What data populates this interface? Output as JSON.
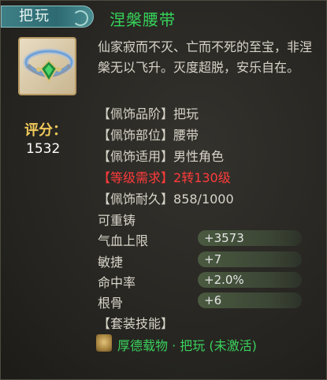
{
  "badge_label": "把玩",
  "item_name": "涅槃腰带",
  "icon": "jade-belt-icon",
  "description": "仙家寂而不灭、亡而不死的至宝，非涅槃无以飞升。灭度超脱，安乐自在。",
  "score": {
    "label": "评分：",
    "value": "1532"
  },
  "attributes": [
    {
      "key": "【佩饰品阶】",
      "value": "把玩"
    },
    {
      "key": "【佩饰部位】",
      "value": "腰带"
    },
    {
      "key": "【佩饰适用】",
      "value": "男性角色"
    },
    {
      "key": "【等级需求】",
      "value": "2转130级"
    },
    {
      "key": "【佩饰耐久】",
      "value": "858/1000"
    }
  ],
  "recastable": "可重铸",
  "stats": [
    {
      "name": "气血上限",
      "value": "+3573"
    },
    {
      "name": "敏捷",
      "value": "+7"
    },
    {
      "name": "命中率",
      "value": "+2.0%"
    },
    {
      "name": "根骨",
      "value": "+6"
    }
  ],
  "set_skill": {
    "header": "【套装技能】",
    "text": "厚德载物 · 把玩 (未激活)"
  },
  "colors": {
    "name_green": "#36d35a",
    "requirement_red": "#ff3b3b",
    "score_gold": "#f0c95a"
  }
}
